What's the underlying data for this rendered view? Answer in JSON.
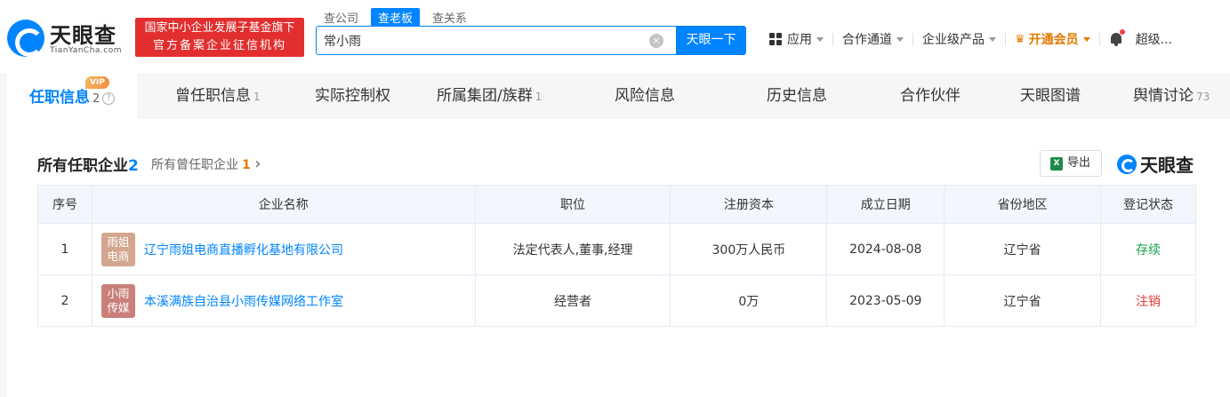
{
  "header": {
    "logo_text": "天眼查",
    "logo_sub": "TianYanCha.com",
    "badge_line1": "国家中小企业发展子基金旗下",
    "badge_line2": "官方备案企业征信机构",
    "search_tabs": [
      "查公司",
      "查老板",
      "查关系"
    ],
    "search_value": "常小雨",
    "clear_icon": "×",
    "search_button": "天眼一下",
    "nav": {
      "apps": "应用",
      "partner_channel": "合作通道",
      "enterprise_products": "企业级产品",
      "vip": "开通会员",
      "crown_icon": "♛",
      "user": "超级..."
    }
  },
  "tabs": [
    {
      "label": "任职信息",
      "count": "2",
      "vip": "VIP",
      "help": "?"
    },
    {
      "label": "曾任职信息",
      "count": "1"
    },
    {
      "label": "实际控制权",
      "count": ""
    },
    {
      "label": "所属集团/族群",
      "count": "1"
    },
    {
      "label": "风险信息",
      "count": ""
    },
    {
      "label": "历史信息",
      "count": ""
    },
    {
      "label": "合作伙伴",
      "count": ""
    },
    {
      "label": "天眼图谱",
      "count": ""
    },
    {
      "label": "舆情讨论",
      "count": "73"
    }
  ],
  "section": {
    "title": "所有任职企业",
    "title_count": "2",
    "past_label": "所有曾任职企业",
    "past_count": "1",
    "past_arrow": "›",
    "export_label": "导出",
    "excel_icon": "X",
    "brand": "天眼查"
  },
  "table": {
    "headers": [
      "序号",
      "企业名称",
      "职位",
      "注册资本",
      "成立日期",
      "省份地区",
      "登记状态"
    ],
    "rows": [
      {
        "index": "1",
        "avatar_line1": "雨姐",
        "avatar_line2": "电商",
        "avatar_color": "#d3a68f",
        "company": "辽宁雨姐电商直播孵化基地有限公司",
        "position": "法定代表人,董事,经理",
        "capital": "300万人民币",
        "founded": "2024-08-08",
        "province": "辽宁省",
        "status": "存续",
        "status_color": "#15a04a"
      },
      {
        "index": "2",
        "avatar_line1": "小雨",
        "avatar_line2": "传媒",
        "avatar_color": "#c98079",
        "company": "本溪满族自治县小雨传媒网络工作室",
        "position": "经营者",
        "capital": "0万",
        "founded": "2023-05-09",
        "province": "辽宁省",
        "status": "注销",
        "status_color": "#e73737"
      }
    ]
  }
}
